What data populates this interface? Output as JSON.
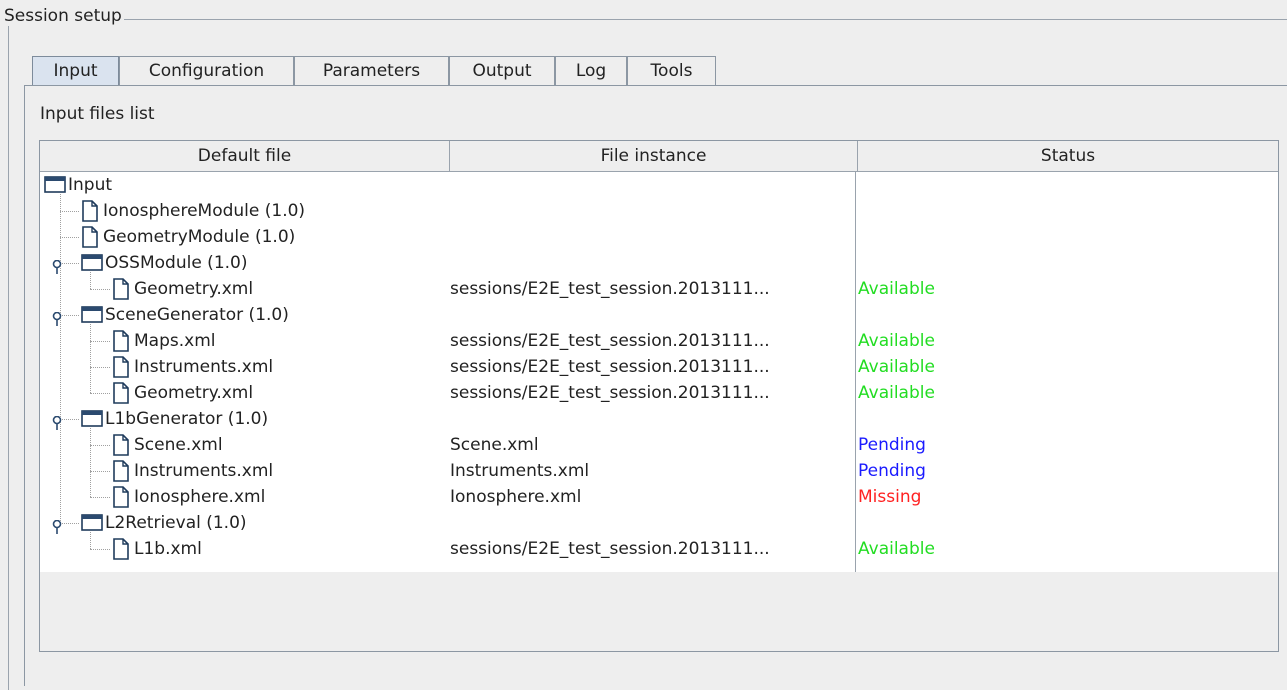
{
  "group": {
    "title": "Session setup"
  },
  "tabs": [
    {
      "label": "Input",
      "active": true
    },
    {
      "label": "Configuration",
      "active": false
    },
    {
      "label": "Parameters",
      "active": false
    },
    {
      "label": "Output",
      "active": false
    },
    {
      "label": "Log",
      "active": false
    },
    {
      "label": "Tools",
      "active": false
    }
  ],
  "panel": {
    "label": "Input files list"
  },
  "table": {
    "columns": [
      "Default file",
      "File instance",
      "Status"
    ],
    "rows": [
      {
        "name": "Input",
        "level": 0,
        "kind": "folder",
        "instance": "",
        "status": ""
      },
      {
        "name": "IonosphereModule (1.0)",
        "level": 1,
        "kind": "file",
        "instance": "",
        "status": ""
      },
      {
        "name": "GeometryModule (1.0)",
        "level": 1,
        "kind": "file",
        "instance": "",
        "status": ""
      },
      {
        "name": "OSSModule (1.0)",
        "level": 1,
        "kind": "folder",
        "instance": "",
        "status": ""
      },
      {
        "name": "Geometry.xml",
        "level": 2,
        "kind": "file",
        "instance": "sessions/E2E_test_session.2013111...",
        "status": "Available"
      },
      {
        "name": "SceneGenerator (1.0)",
        "level": 1,
        "kind": "folder",
        "instance": "",
        "status": ""
      },
      {
        "name": "Maps.xml",
        "level": 2,
        "kind": "file",
        "instance": "sessions/E2E_test_session.2013111...",
        "status": "Available"
      },
      {
        "name": "Instruments.xml",
        "level": 2,
        "kind": "file",
        "instance": "sessions/E2E_test_session.2013111...",
        "status": "Available"
      },
      {
        "name": "Geometry.xml",
        "level": 2,
        "kind": "file",
        "instance": "sessions/E2E_test_session.2013111...",
        "status": "Available"
      },
      {
        "name": "L1bGenerator (1.0)",
        "level": 1,
        "kind": "folder",
        "instance": "",
        "status": ""
      },
      {
        "name": "Scene.xml",
        "level": 2,
        "kind": "file",
        "instance": "Scene.xml",
        "status": "Pending"
      },
      {
        "name": "Instruments.xml",
        "level": 2,
        "kind": "file",
        "instance": "Instruments.xml",
        "status": "Pending"
      },
      {
        "name": "Ionosphere.xml",
        "level": 2,
        "kind": "file",
        "instance": "Ionosphere.xml",
        "status": "Missing"
      },
      {
        "name": "L2Retrieval (1.0)",
        "level": 1,
        "kind": "folder",
        "instance": "",
        "status": ""
      },
      {
        "name": "L1b.xml",
        "level": 2,
        "kind": "file",
        "instance": "sessions/E2E_test_session.2013111...",
        "status": "Available"
      }
    ]
  },
  "status_colors": {
    "Available": "#22dd22",
    "Pending": "#1a1aff",
    "Missing": "#ff2222"
  },
  "icons": {
    "folder": "folder-icon",
    "file": "file-icon",
    "expand": "expand-handle-icon"
  }
}
